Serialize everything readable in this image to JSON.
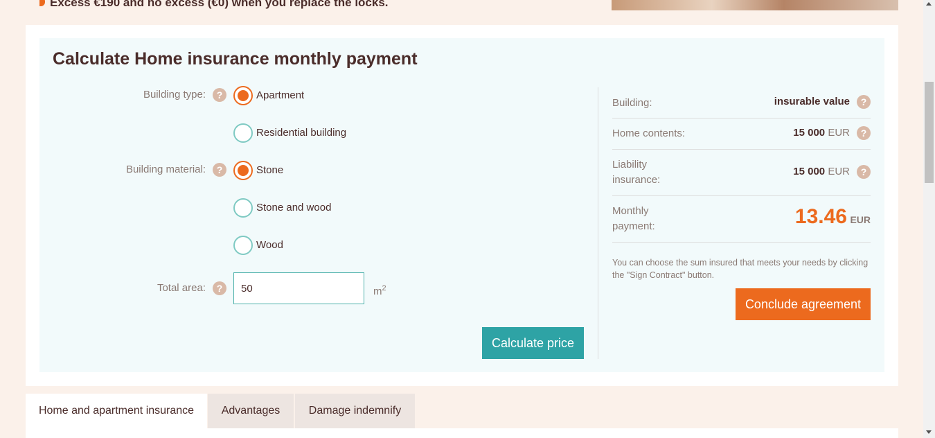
{
  "banner": {
    "text": "Excess €190 and no excess (€0) when you replace the locks."
  },
  "calculator": {
    "title": "Calculate Home insurance monthly payment",
    "building_type": {
      "label": "Building type:",
      "options": [
        {
          "label": "Apartment",
          "selected": true
        },
        {
          "label": "Residential building",
          "selected": false
        }
      ]
    },
    "building_material": {
      "label": "Building material:",
      "options": [
        {
          "label": "Stone",
          "selected": true
        },
        {
          "label": "Stone and wood",
          "selected": false
        },
        {
          "label": "Wood",
          "selected": false
        }
      ]
    },
    "total_area": {
      "label": "Total area:",
      "value": "50",
      "unit": "m",
      "unit_sup": "2"
    },
    "help_glyph": "?",
    "calculate_button": "Calculate price"
  },
  "summary": {
    "building": {
      "label": "Building:",
      "value": "insurable value"
    },
    "home_contents": {
      "label": "Home contents:",
      "value": "15 000",
      "currency": "EUR"
    },
    "liability": {
      "label": "Liability insurance:",
      "value": "15 000",
      "currency": "EUR"
    },
    "monthly": {
      "label": "Monthly payment:",
      "value": "13.46",
      "currency": "EUR"
    },
    "note": "You can choose the sum insured that meets your needs by clicking the \"Sign Contract\" button.",
    "conclude_button": "Conclude agreement"
  },
  "tabs": [
    {
      "label": "Home and apartment insurance",
      "active": true
    },
    {
      "label": "Advantages",
      "active": false
    },
    {
      "label": "Damage indemnify",
      "active": false
    }
  ],
  "colors": {
    "accent_orange": "#ec6a1e",
    "accent_teal": "#2ea3a5",
    "text_dark": "#4a2c2a",
    "panel_bg": "#f2fafb",
    "page_bg": "#fbf1ea"
  }
}
